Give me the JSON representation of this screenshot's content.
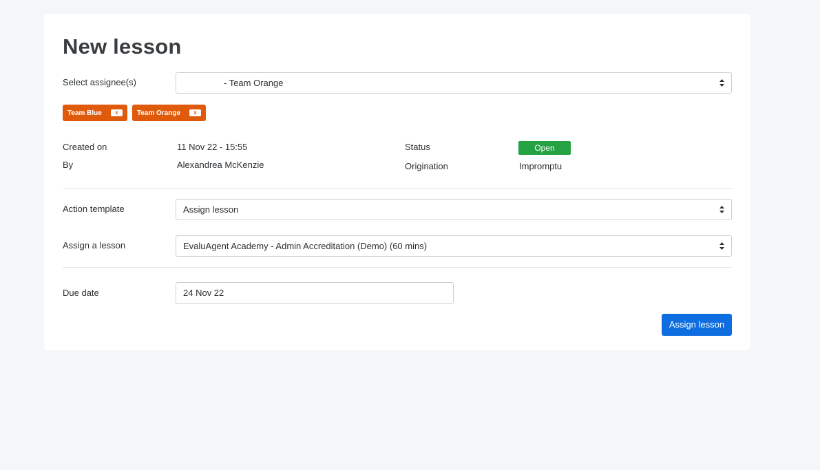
{
  "page": {
    "title": "New lesson"
  },
  "assignees": {
    "label": "Select assignee(s)",
    "selected": "- Team Orange",
    "tags": [
      {
        "label": "Team Blue",
        "remove": "x"
      },
      {
        "label": "Team Orange",
        "remove": "x"
      }
    ]
  },
  "meta": {
    "created_on_label": "Created on",
    "created_on_value": "11 Nov 22 - 15:55",
    "by_label": "By",
    "by_value": "Alexandrea McKenzie",
    "status_label": "Status",
    "status_value": "Open",
    "origination_label": "Origination",
    "origination_value": "Impromptu"
  },
  "action_template": {
    "label": "Action template",
    "selected": "Assign lesson"
  },
  "lesson": {
    "label": "Assign a lesson",
    "selected": "EvaluAgent Academy - Admin Accreditation (Demo) (60 mins)"
  },
  "due_date": {
    "label": "Due date",
    "value": "24 Nov 22"
  },
  "submit": {
    "label": "Assign lesson"
  },
  "colors": {
    "tag": "#e05a0c",
    "status_open": "#25a244",
    "primary_button": "#0e6ee0",
    "background": "#f5f6fa"
  },
  "icons": {
    "select_caret": "updown-caret-icon"
  }
}
